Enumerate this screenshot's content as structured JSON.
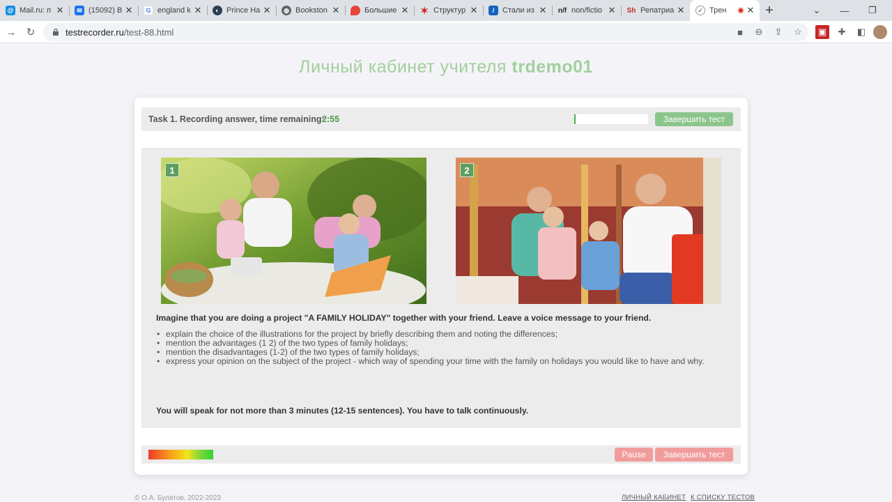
{
  "browser": {
    "tabs": [
      {
        "title": "Mail.ru: п",
        "icon": "mailru-icon",
        "color": "#168de2"
      },
      {
        "title": "(15092) В",
        "icon": "mail-icon",
        "color": "#1a73e8"
      },
      {
        "title": "england k",
        "icon": "google-icon",
        "color": "#4285f4"
      },
      {
        "title": "Prince Ha",
        "icon": "site-icon",
        "color": "#2c3e50"
      },
      {
        "title": "Bookston",
        "icon": "globe-icon",
        "color": "#5f6368"
      },
      {
        "title": "Большие",
        "icon": "map-pin-icon",
        "color": "#e8453c"
      },
      {
        "title": "Структур",
        "icon": "star-logo-icon",
        "color": "#c62828"
      },
      {
        "title": "Стали из",
        "icon": "slash-logo-icon",
        "color": "#1565c0"
      },
      {
        "title": "non/fictio",
        "icon": "nf-logo-icon",
        "color": "#222222"
      },
      {
        "title": "Репатриа",
        "icon": "sh-logo-icon",
        "color": "#c62828"
      },
      {
        "title": "Трен",
        "icon": "testrecorder-icon",
        "color": "#777777"
      }
    ],
    "url_host": "testrecorder.ru",
    "url_path": "/test-88.html"
  },
  "page": {
    "title_prefix": "Личный кабинет учителя",
    "title_user": "trdemo01"
  },
  "topbar": {
    "status_label": "Task 1. Recording answer, time remaining:",
    "time_remaining": "2:55",
    "finish_button": "Завершить тест"
  },
  "task": {
    "photo1_number": "1",
    "photo2_number": "2",
    "instruction": "Imagine that you are doing a project \"A FAMILY HOLIDAY\" together with your friend. Leave a voice message to your friend.",
    "bullets": [
      "explain the choice of the illustrations for the project by briefly describing them and noting the differences;",
      "mention the advantages (1 2) of the two types of family holidays;",
      "mention the disadvantages (1-2) of the two types of family holidays;",
      "express your opinion on the subject of the project - which way of spending your time with the family on holidays you would like to have and why."
    ],
    "footnote": "You will speak for not more than 3 minutes (12-15 sentences). You have to talk continuously."
  },
  "bottombar": {
    "pause_button": "Pause",
    "finish_button": "Завершить тест"
  },
  "footer": {
    "copyright": "© О.А. Булатов, 2022-2023",
    "link_cabinet": "ЛИЧНЫЙ КАБИНЕТ",
    "link_tests": "К СПИСКУ ТЕСТОВ"
  },
  "colors": {
    "accent_green": "#8cc58b",
    "title_green": "#a2cf9c",
    "timer_green": "#4e9a4a",
    "danger_pink": "#f19c9c"
  }
}
